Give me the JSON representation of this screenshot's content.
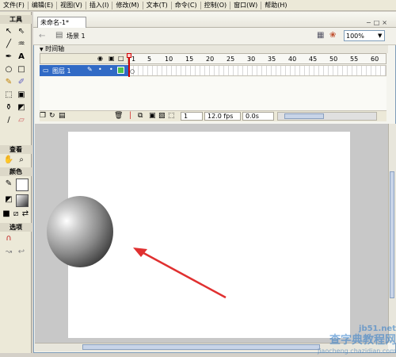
{
  "menu": [
    "文件(F)",
    "编辑(E)",
    "视图(V)",
    "插入(I)",
    "修改(M)",
    "文本(T)",
    "命令(C)",
    "控制(O)",
    "窗口(W)",
    "帮助(H)"
  ],
  "tools": {
    "title": "工具",
    "view_title": "查看",
    "color_title": "颜色",
    "options_title": "选项"
  },
  "document": {
    "tab": "未命名-1*",
    "scene": "场景 1",
    "zoom": "100%"
  },
  "timeline": {
    "title": "时间轴",
    "ruler": [
      "1",
      "5",
      "10",
      "15",
      "20",
      "25",
      "30",
      "35",
      "40",
      "45",
      "50",
      "55",
      "60"
    ],
    "layer": "图层 1",
    "frame": "1",
    "fps": "12.0 fps",
    "time": "0.0s"
  },
  "watermark": {
    "text": "查字典教程网",
    "url": "jiaocheng.chazidian.com",
    "site": "jb51.net"
  },
  "colors": {
    "selection": "#316ac5",
    "arrow": "#e03030",
    "playhead": "#cc0000"
  }
}
